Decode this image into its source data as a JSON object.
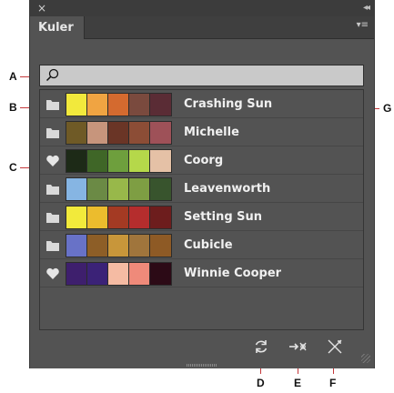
{
  "panel": {
    "close_glyph": "×",
    "collapse_glyph": "◂◂",
    "tab_label": "Kuler",
    "menu_glyph": "▾≡",
    "search": {
      "value": "",
      "placeholder": ""
    }
  },
  "themes": [
    {
      "name": "Crashing Sun",
      "icon": "folder-icon",
      "colors": [
        "#f2e93c",
        "#f0a442",
        "#d46a2f",
        "#7a4a3e",
        "#5a2c35"
      ]
    },
    {
      "name": "Michelle",
      "icon": "folder-icon",
      "colors": [
        "#6f5a26",
        "#c7957c",
        "#6a3526",
        "#8c4d36",
        "#9e5158"
      ]
    },
    {
      "name": "Coorg",
      "icon": "heart-icon",
      "colors": [
        "#1d2a17",
        "#3f6627",
        "#6e9f3d",
        "#b5d84a",
        "#e5c1a6"
      ]
    },
    {
      "name": "Leavenworth",
      "icon": "folder-icon",
      "colors": [
        "#86b5e3",
        "#6b8a45",
        "#98b84a",
        "#7e9e43",
        "#38542d"
      ]
    },
    {
      "name": "Setting Sun",
      "icon": "folder-icon",
      "colors": [
        "#f2ea3b",
        "#ecbc2d",
        "#a43a23",
        "#b52d2d",
        "#6d1d1d"
      ]
    },
    {
      "name": "Cubicle",
      "icon": "folder-icon",
      "colors": [
        "#6872c7",
        "#8d5e27",
        "#c8963a",
        "#a0753c",
        "#8e5a25"
      ]
    },
    {
      "name": "Winnie Cooper",
      "icon": "heart-icon",
      "colors": [
        "#3e1f6d",
        "#3b2277",
        "#f5bba3",
        "#ef8a7a",
        "#2c0a16"
      ]
    }
  ],
  "toolbar": {
    "refresh": "refresh-icon",
    "add_to_swatches": "add-to-swatches-icon",
    "edit": "edit-theme-icon"
  },
  "callouts": {
    "a": "A",
    "b": "B",
    "c": "C",
    "d": "D",
    "e": "E",
    "f": "F",
    "g": "G"
  }
}
